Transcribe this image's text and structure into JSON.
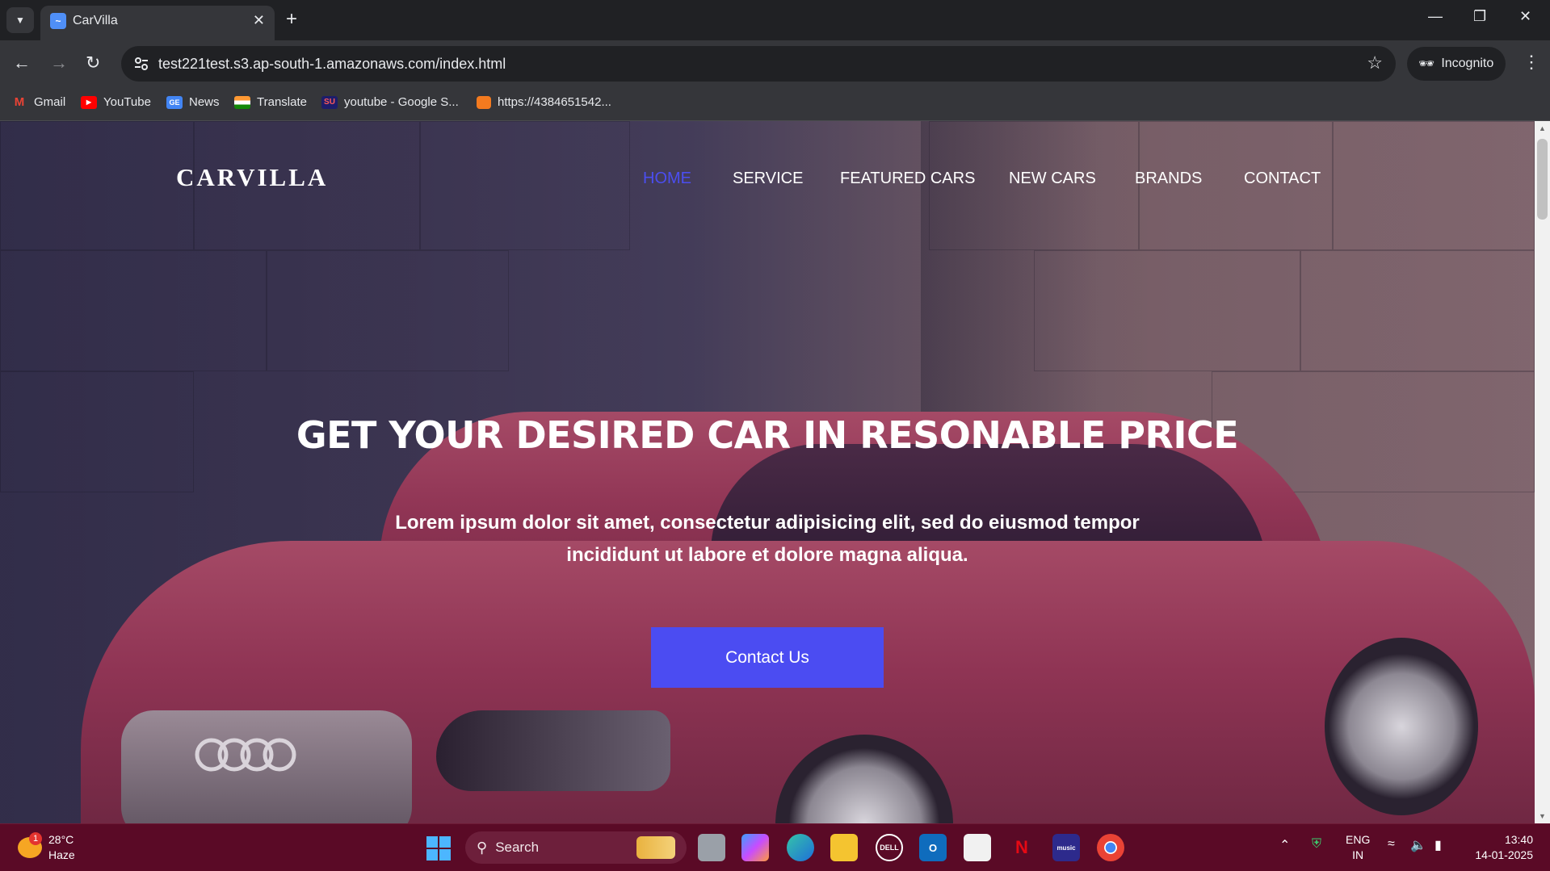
{
  "browser": {
    "tab": {
      "title": "CarVilla",
      "favicon": "carvilla-favicon"
    },
    "url": "test221test.s3.ap-south-1.amazonaws.com/index.html",
    "incognito_label": "Incognito",
    "bookmarks": [
      {
        "label": "Gmail",
        "icon": "gmail-icon"
      },
      {
        "label": "YouTube",
        "icon": "youtube-icon"
      },
      {
        "label": "News",
        "icon": "news-icon"
      },
      {
        "label": "Translate",
        "icon": "translate-icon"
      },
      {
        "label": "youtube - Google S...",
        "icon": "su-icon"
      },
      {
        "label": "https://4384651542...",
        "icon": "cube-icon"
      }
    ]
  },
  "site": {
    "logo": "CARVILLA",
    "nav": [
      {
        "label": "HOME",
        "active": true
      },
      {
        "label": "SERVICE",
        "active": false
      },
      {
        "label": "FEATURED CARS",
        "active": false
      },
      {
        "label": "NEW CARS",
        "active": false
      },
      {
        "label": "BRANDS",
        "active": false
      },
      {
        "label": "CONTACT",
        "active": false
      }
    ],
    "hero": {
      "title": "GET YOUR DESIRED CAR IN RESONABLE PRICE",
      "text_line1": "Lorem ipsum dolor sit amet, consectetur adipisicing elit, sed do eiusmod tempor",
      "text_line2": "incididunt ut labore et dolore magna aliqua.",
      "button": "Contact Us"
    },
    "colors": {
      "accent": "#4b4ef0",
      "button": "#4b4cf2"
    }
  },
  "taskbar": {
    "weather": {
      "temp": "28°C",
      "condition": "Haze",
      "badge": "1"
    },
    "search_label": "Search",
    "apps": [
      "task-view-icon",
      "copilot-icon",
      "edge-icon",
      "file-explorer-icon",
      "dell-icon",
      "outlook-icon",
      "store-icon",
      "netflix-icon",
      "amazon-music-icon",
      "chrome-icon"
    ],
    "lang_line1": "ENG",
    "lang_line2": "IN",
    "time": "13:40",
    "date": "14-01-2025"
  }
}
